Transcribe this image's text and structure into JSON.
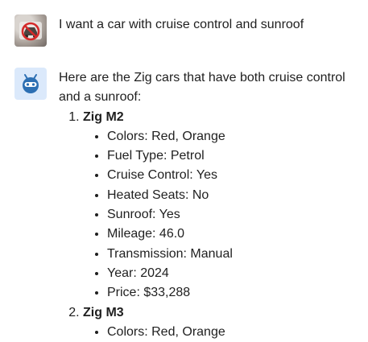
{
  "user_message": {
    "text": "I want a car with cruise control and sunroof"
  },
  "bot_message": {
    "intro": "Here are the Zig cars that have both cruise control and a sunroof:",
    "cars": [
      {
        "name": "Zig M2",
        "props": [
          "Colors: Red, Orange",
          "Fuel Type: Petrol",
          "Cruise Control: Yes",
          "Heated Seats: No",
          "Sunroof: Yes",
          "Mileage: 46.0",
          "Transmission: Manual",
          "Year: 2024",
          "Price: $33,288"
        ]
      },
      {
        "name": "Zig M3",
        "props": [
          "Colors: Red, Orange"
        ]
      }
    ]
  },
  "colors": {
    "bot_avatar_bg": "#dbe9fb",
    "bot_icon": "#2c6fb3",
    "no_sign": "#d42a2a"
  }
}
